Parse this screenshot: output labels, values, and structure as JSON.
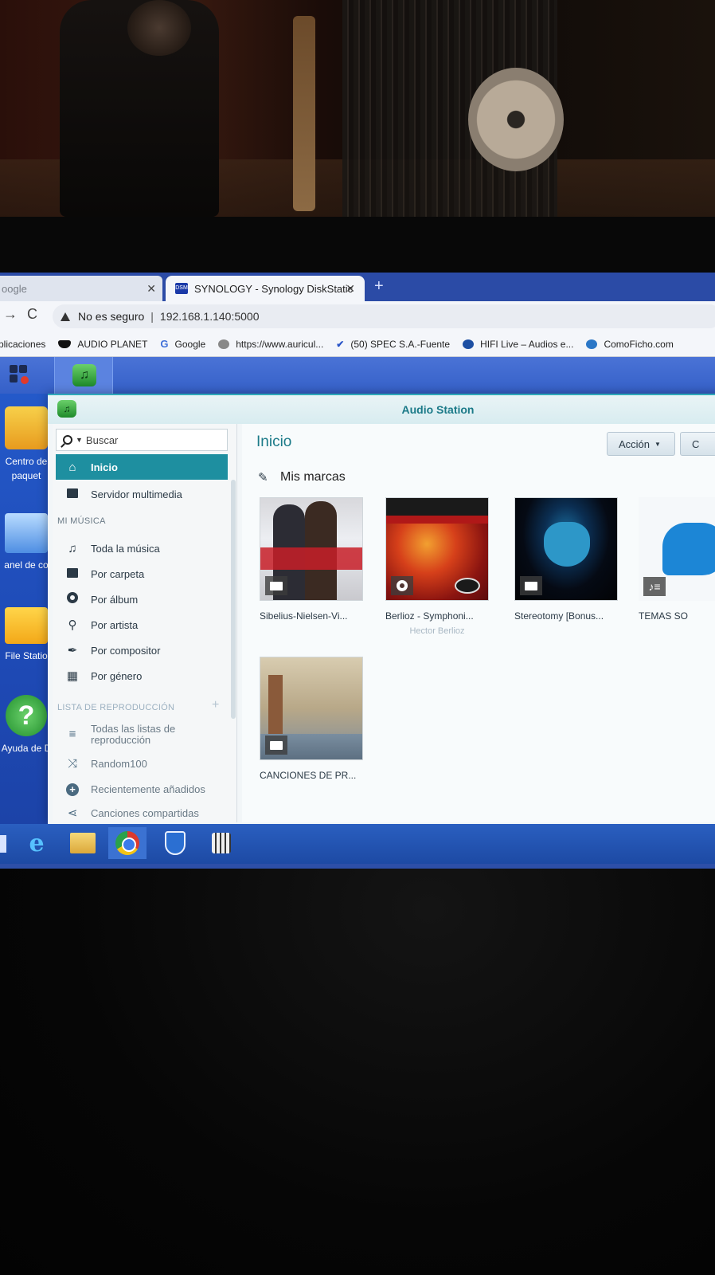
{
  "browser": {
    "tabs": [
      {
        "label": "oogle",
        "active": false
      },
      {
        "label": "SYNOLOGY - Synology DiskStatic",
        "active": true,
        "favicon": "DSM"
      }
    ],
    "close_glyph": "✕",
    "new_tab_glyph": "+",
    "address": {
      "security_label": "No es seguro",
      "url": "192.168.1.140:5000"
    },
    "bookmarks": [
      {
        "label": "plicaciones",
        "icon": "apps-icon"
      },
      {
        "label": "AUDIO PLANET",
        "icon": "audio-planet-icon"
      },
      {
        "label": "Google",
        "icon": "google-icon",
        "glyph": "G"
      },
      {
        "label": "https://www.auricul...",
        "icon": "site-icon"
      },
      {
        "label": "(50) SPEC S.A.-Fuente",
        "icon": "check-icon",
        "glyph": "✔"
      },
      {
        "label": "HIFI Live – Audios e...",
        "icon": "wordpress-icon"
      },
      {
        "label": "ComoFicho.com",
        "icon": "comoficho-icon"
      }
    ]
  },
  "desktop": {
    "icons": [
      {
        "label": "Centro de paquet",
        "icon": "package-center-icon"
      },
      {
        "label": "anel de co",
        "icon": "control-panel-icon"
      },
      {
        "label": "File Statio",
        "icon": "file-station-icon"
      },
      {
        "label": "Ayuda de D",
        "icon": "help-icon",
        "glyph": "?"
      }
    ]
  },
  "window": {
    "title": "Audio Station",
    "search_placeholder": "Buscar",
    "nav": {
      "top": [
        {
          "label": "Inicio",
          "icon": "home-icon",
          "active": true
        },
        {
          "label": "Servidor multimedia",
          "icon": "media-server-icon",
          "active": false
        }
      ],
      "my_music_header": "MI MÚSICA",
      "my_music": [
        {
          "label": "Toda la música",
          "icon": "music-note-icon",
          "glyph": "♫"
        },
        {
          "label": "Por carpeta",
          "icon": "folder-icon"
        },
        {
          "label": "Por álbum",
          "icon": "album-icon"
        },
        {
          "label": "Por artista",
          "icon": "microphone-icon",
          "glyph": "🎤"
        },
        {
          "label": "Por compositor",
          "icon": "pen-icon",
          "glyph": "✒"
        },
        {
          "label": "Por género",
          "icon": "genre-grid-icon",
          "glyph": "▦"
        }
      ],
      "playlist_header": "LISTA DE REPRODUCCIÓN",
      "playlist_add": "+",
      "playlists": [
        {
          "label": "Todas las listas de reproducción",
          "icon": "playlists-icon",
          "glyph": "≡"
        },
        {
          "label": "Random100",
          "icon": "shuffle-icon",
          "glyph": "⤨"
        },
        {
          "label": "Recientemente añadidos",
          "icon": "recently-added-icon",
          "glyph": "+"
        },
        {
          "label": "Canciones compartidas",
          "icon": "share-icon",
          "glyph": "⋖"
        }
      ]
    },
    "main": {
      "breadcrumb": "Inicio",
      "action_button": "Acción",
      "second_button": "C",
      "section_title": "Mis marcas",
      "pin_glyph": "📌",
      "cards": [
        {
          "title": "Sibelius-Nielsen-Vi...",
          "subtitle": "",
          "badge": "folder"
        },
        {
          "title": "Berlioz - Symphoni...",
          "subtitle": "Hector Berlioz",
          "badge": "disc"
        },
        {
          "title": "Stereotomy [Bonus...",
          "subtitle": "",
          "badge": "folder"
        },
        {
          "title": "TEMAS SO",
          "subtitle": "",
          "badge": "playlist",
          "badge_glyph": "♪≡"
        },
        {
          "title": "CANCIONES DE PR...",
          "subtitle": "",
          "badge": "folder"
        }
      ]
    }
  },
  "taskbar": {
    "items": [
      {
        "name": "internet-explorer-icon",
        "glyph": "e"
      },
      {
        "name": "file-explorer-icon"
      },
      {
        "name": "chrome-icon",
        "active": true
      },
      {
        "name": "security-shield-icon"
      },
      {
        "name": "app-grid-icon"
      }
    ]
  },
  "colors": {
    "accent": "#1e8fa0",
    "title_text": "#1b7a88",
    "desktop_blue": "#2459c9",
    "tabstrip": "#2b4ba6"
  }
}
